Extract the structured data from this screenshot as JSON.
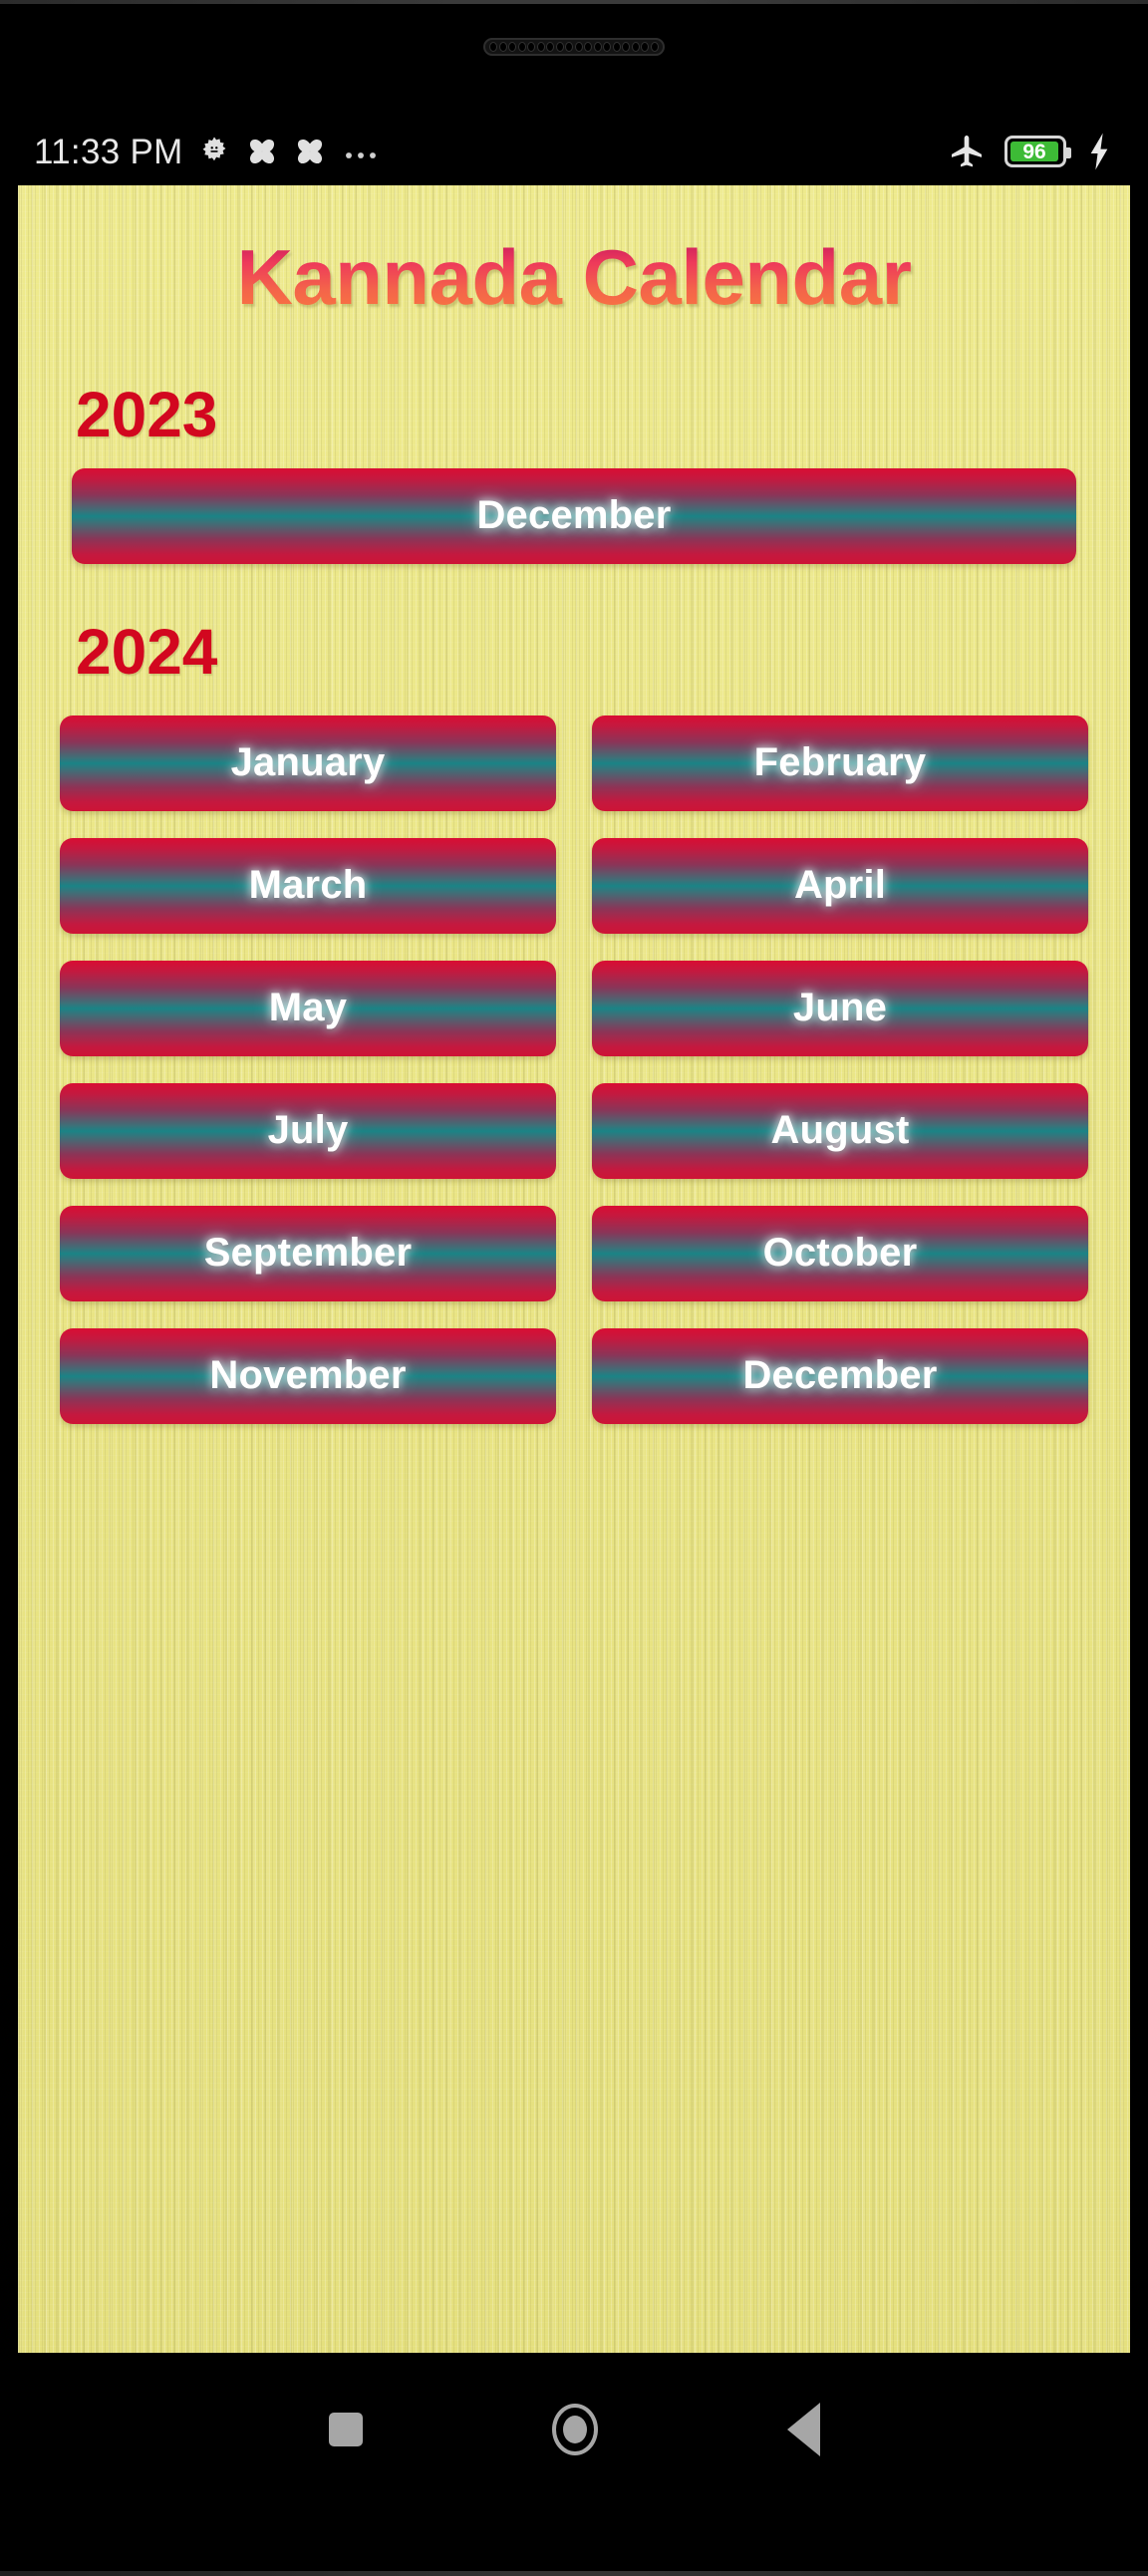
{
  "status_bar": {
    "time": "11:33 PM",
    "left_icons": [
      "gear-icon",
      "clover-icon",
      "clover-icon",
      "overflow-dots-icon"
    ],
    "right_icons": [
      "airplane-mode-icon",
      "battery-icon",
      "charging-bolt-icon"
    ],
    "battery_level": "96",
    "battery_color": "#3dbb36"
  },
  "app": {
    "title": "Kannada Calendar",
    "title_gradient_from": "#2a1a66",
    "title_gradient_to": "#f97b3f",
    "background_color": "#ece887",
    "year_heading_color": "#d2071f",
    "button_accent_red": "#cd1436",
    "button_accent_teal": "#1a8486",
    "button_text_color": "#ffffff"
  },
  "sections": [
    {
      "year": "2023",
      "months": [
        "December"
      ]
    },
    {
      "year": "2024",
      "months": [
        "January",
        "February",
        "March",
        "April",
        "May",
        "June",
        "July",
        "August",
        "September",
        "October",
        "November",
        "December"
      ]
    }
  ],
  "nav_bar": {
    "recents_label": "recents-button",
    "home_label": "home-button",
    "back_label": "back-button"
  }
}
